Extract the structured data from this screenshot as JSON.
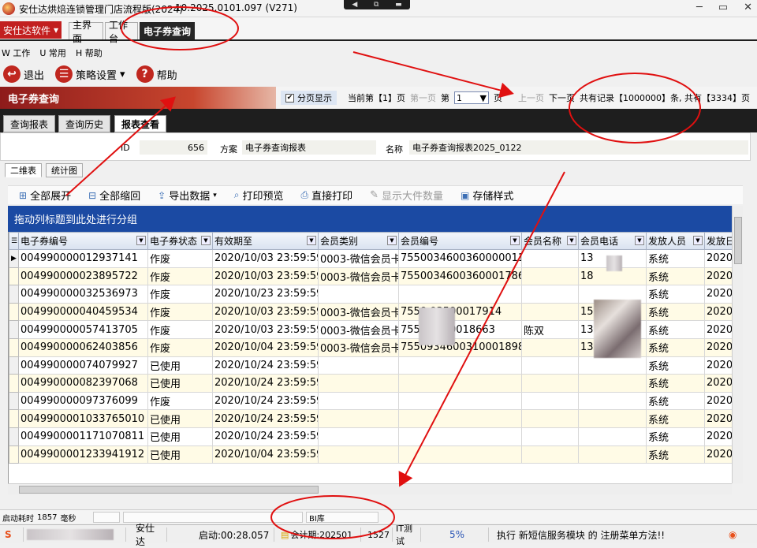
{
  "window": {
    "title": "安仕达烘焙连锁管理门店流程版(2024)",
    "version": "10.2025.0101.097 (V271)",
    "remote_controls": [
      "◀",
      "⧉",
      "▬"
    ],
    "buttons": [
      "─",
      "▭",
      "✕"
    ]
  },
  "brand": {
    "label": "安仕达软件",
    "arrow": "▾"
  },
  "module_tabs": [
    "主界面",
    "工作台",
    "电子券查询"
  ],
  "menu": [
    "W 工作",
    "U 常用",
    "H 帮助"
  ],
  "toolbar": {
    "exit": "退出",
    "strategy": "策略设置",
    "strategy_arrow": "▾",
    "help": "帮助"
  },
  "header": {
    "title": "电子券查询",
    "paging_label": "分页显示",
    "paging_checked": "✔",
    "current_page": "当前第【1】页",
    "first_page": "第一页",
    "page_prefix": "第",
    "page_value": "1",
    "page_suffix": "页",
    "prev_page": "上一页",
    "next_page": "下一页",
    "total": "共有记录【1000000】条, 共有【3334】页"
  },
  "inner_tabs": [
    "查询报表",
    "查询历史",
    "报表查看"
  ],
  "info": {
    "id_label": "ID",
    "id_value": "656",
    "scheme_label": "方案",
    "scheme_value": "电子券查询报表",
    "name_label": "名称",
    "name_value": "电子券查询报表2025_0122"
  },
  "sub_tabs": [
    "二维表",
    "统计图"
  ],
  "grid_toolbar": {
    "expand_all": "全部展开",
    "collapse_all": "全部缩回",
    "export": "导出数据",
    "export_arrow": "▾",
    "preview": "打印预览",
    "print": "直接打印",
    "show_count": "显示大件数量",
    "save_style": "存储样式"
  },
  "group_panel": "拖动列标题到此处进行分组",
  "table": {
    "columns": [
      "电子券编号",
      "电子券状态",
      "有效期至",
      "会员类别",
      "会员编号",
      "会员名称",
      "会员电话",
      "发放人员",
      "发放日"
    ],
    "rows": [
      [
        "004990000012937141",
        "作废",
        "2020/10/03 23:59:59",
        "0003-微信会员卡",
        "75500346003600000114",
        "",
        "13",
        "系统",
        "2020/"
      ],
      [
        "004990000023895722",
        "作废",
        "2020/10/03 23:59:59",
        "0003-微信会员卡",
        "75500346003600017860",
        "",
        "18",
        "系统",
        "2020/"
      ],
      [
        "004990000032536973",
        "作废",
        "2020/10/23 23:59:59",
        "",
        "",
        "",
        "",
        "系统",
        "2020/"
      ],
      [
        "004990000040459534",
        "作废",
        "2020/10/03 23:59:59",
        "0003-微信会员卡",
        "7550        03500017914",
        "",
        "15",
        "系统",
        "2020/"
      ],
      [
        "004990000057413705",
        "作废",
        "2020/10/03 23:59:59",
        "0003-微信会员卡",
        "755        03100018663",
        "陈双",
        "13",
        "系统",
        "2020/"
      ],
      [
        "004990000062403856",
        "作废",
        "2020/10/04 23:59:59",
        "0003-微信会员卡",
        "75509346003100018984",
        "",
        "13",
        "系统",
        "2020/"
      ],
      [
        "004990000074079927",
        "已使用",
        "2020/10/24 23:59:59",
        "",
        "",
        "",
        "",
        "系统",
        "2020/"
      ],
      [
        "004990000082397068",
        "已使用",
        "2020/10/24 23:59:59",
        "",
        "",
        "",
        "",
        "系统",
        "2020/"
      ],
      [
        "004990000097376099",
        "作废",
        "2020/10/24 23:59:59",
        "",
        "",
        "",
        "",
        "系统",
        "2020/"
      ],
      [
        "0049900001033765010",
        "已使用",
        "2020/10/24 23:59:59",
        "",
        "",
        "",
        "",
        "系统",
        "2020/"
      ],
      [
        "0049900001171070811",
        "已使用",
        "2020/10/24 23:59:59",
        "",
        "",
        "",
        "",
        "系统",
        "2020/"
      ],
      [
        "0049900001233941912",
        "已使用",
        "2020/10/04 23:59:59",
        "",
        "",
        "",
        "",
        "系统",
        "2020/"
      ]
    ]
  },
  "status_bar": {
    "startup_label": "启动耗时",
    "startup_value": "1857",
    "startup_unit": "毫秒",
    "db": "BI库",
    "app": "安仕达",
    "uptime": "启动:00:28.057",
    "period": "会计期:202501",
    "code": "1527",
    "it": "IT测试",
    "percent": "5%",
    "message": "执行  新短信服务模块  的  注册菜单方法!!"
  },
  "colors": {
    "brand_red": "#c21f1f",
    "group_panel_blue": "#1b4aa3",
    "annotation_red": "#e01010"
  }
}
